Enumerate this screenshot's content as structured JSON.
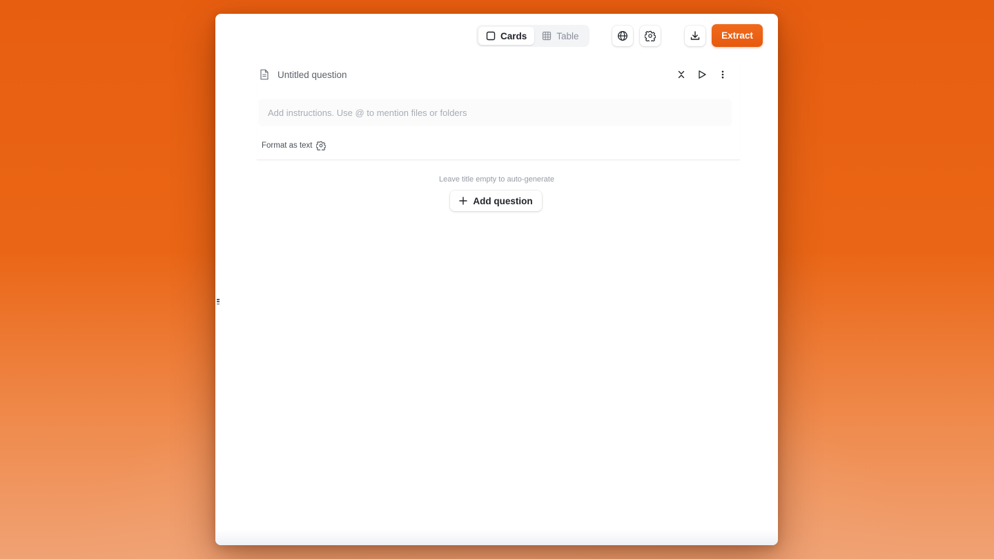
{
  "toolbar": {
    "view_toggle": {
      "cards_label": "Cards",
      "table_label": "Table",
      "selected": "Cards"
    },
    "globe_icon": "globe-icon",
    "settings_icon": "gear-icon",
    "download_icon": "download-icon",
    "extract_label": "Extract"
  },
  "question": {
    "title": "Untitled question",
    "instructions_placeholder": "Add instructions. Use @ to mention files or folders",
    "instructions_value": "",
    "format_label": "Format as text",
    "actions": [
      "collapse-icon",
      "play-icon",
      "more-vertical-icon"
    ]
  },
  "hint": "Leave title empty to auto-generate",
  "add_question_label": "Add question",
  "colors": {
    "accent": "#e95e10",
    "background_top": "#e85e10",
    "background_bottom": "#f0a274",
    "window": "#ffffff"
  }
}
